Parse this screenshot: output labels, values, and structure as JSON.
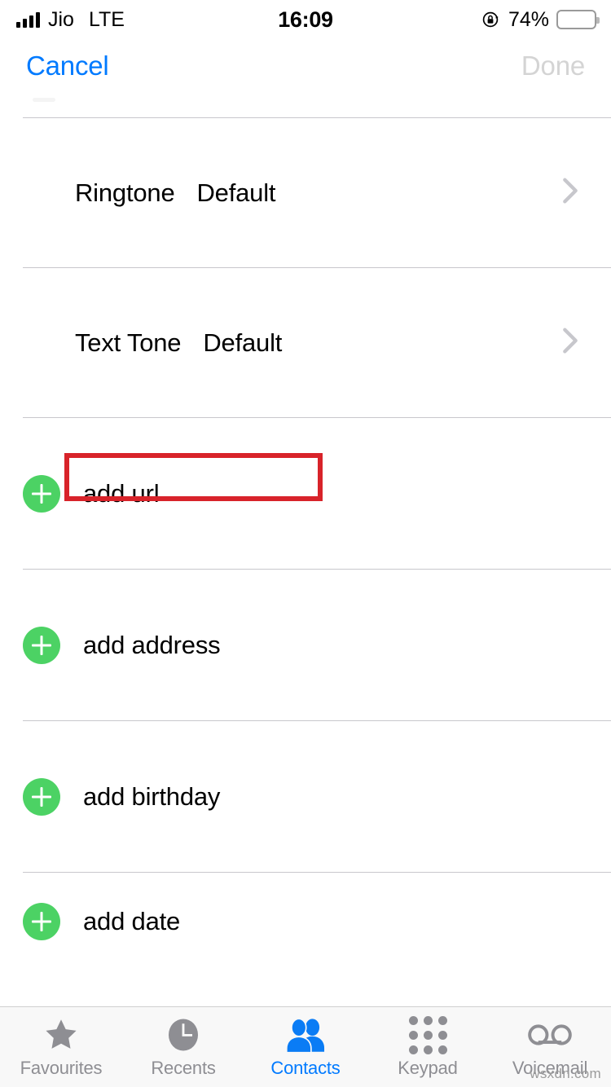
{
  "status_bar": {
    "carrier": "Jio",
    "network": "LTE",
    "time": "16:09",
    "battery_percent": "74%",
    "battery_level": 74,
    "rotation_lock_icon": "rotation-lock-icon",
    "signal_bars": 4
  },
  "nav_bar": {
    "cancel_label": "Cancel",
    "done_label": "Done",
    "cancel_color": "#007AFF",
    "done_color": "#D4D4D4"
  },
  "tone_rows": [
    {
      "label": "Ringtone",
      "value": "Default",
      "highlighted": false
    },
    {
      "label": "Text Tone",
      "value": "Default",
      "highlighted": true
    }
  ],
  "add_rows": [
    {
      "label": "add url"
    },
    {
      "label": "add address"
    },
    {
      "label": "add birthday"
    },
    {
      "label": "add date"
    }
  ],
  "annotation": {
    "type": "red-rectangle-highlight",
    "target": "Text Tone",
    "color": "#D8232A"
  },
  "tab_bar": {
    "active_color": "#007AFF",
    "inactive_color": "#8E8E93",
    "tabs": [
      {
        "label": "Favourites",
        "icon": "star-icon",
        "active": false
      },
      {
        "label": "Recents",
        "icon": "clock-icon",
        "active": false
      },
      {
        "label": "Contacts",
        "icon": "contacts-icon",
        "active": true
      },
      {
        "label": "Keypad",
        "icon": "keypad-icon",
        "active": false
      },
      {
        "label": "Voicemail",
        "icon": "voicemail-icon",
        "active": false
      }
    ]
  },
  "watermark": {
    "text": "wsxdn.com"
  },
  "colors": {
    "accent_blue": "#007AFF",
    "add_green": "#4CD264",
    "separator": "#C8C7CC",
    "annotation_red": "#D8232A"
  }
}
